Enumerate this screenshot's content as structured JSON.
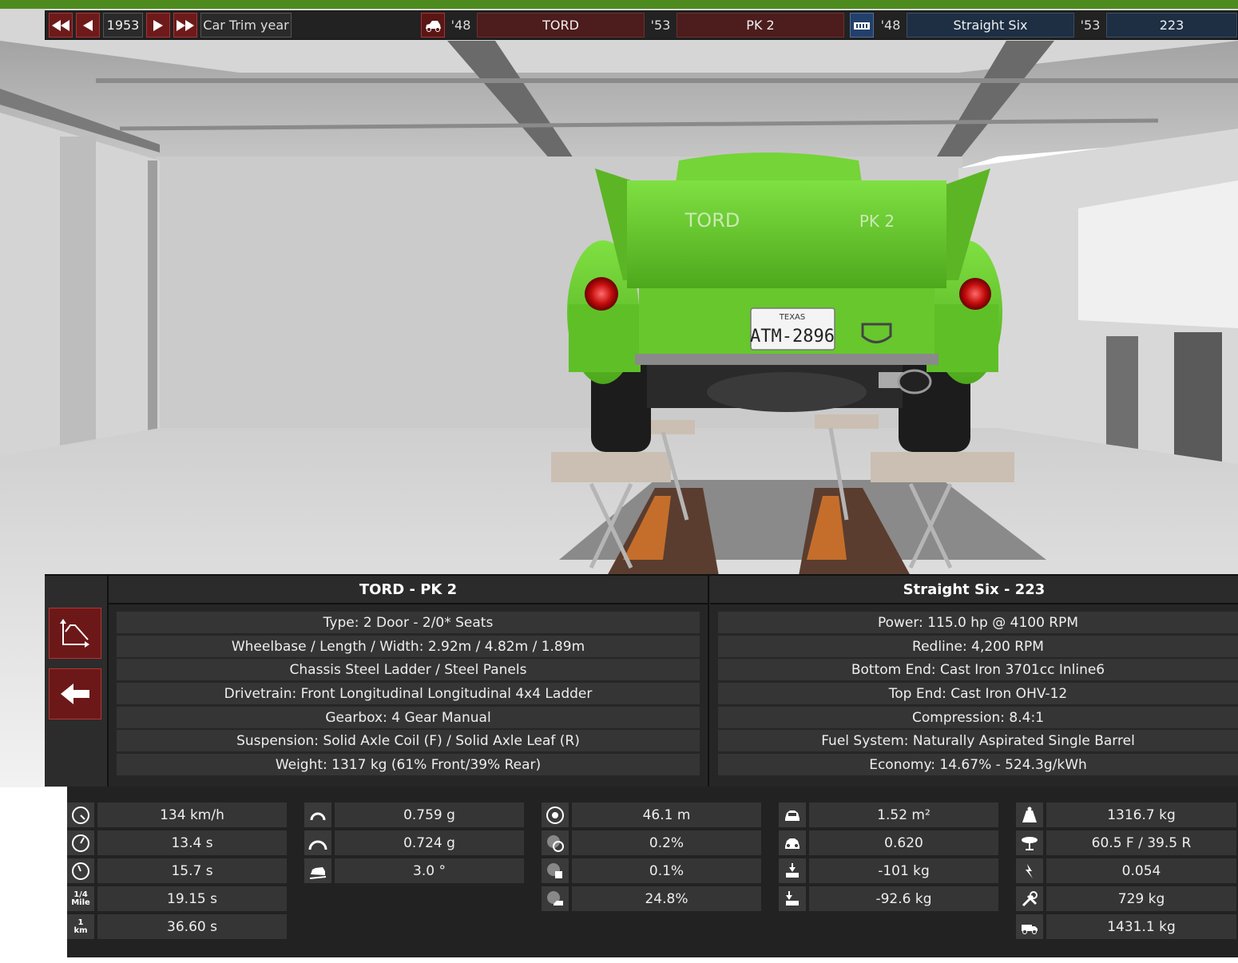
{
  "toolbar": {
    "year": "1953",
    "trim_label": "Car Trim year",
    "car_year_start": "'48",
    "car_make": "TORD",
    "car_year_end": "'53",
    "car_model": "PK 2",
    "engine_year_start": "'48",
    "engine_family": "Straight Six",
    "engine_year_end": "'53",
    "engine_variant": "223",
    "icons": [
      "fast-back-icon",
      "back-icon",
      "forward-icon",
      "fast-forward-icon",
      "car-icon",
      "engine-icon"
    ]
  },
  "plate": {
    "state": "TEXAS",
    "number": "ATM-2896"
  },
  "car_badges": {
    "left": "TORD",
    "right": "PK 2"
  },
  "car_panel": {
    "title": "TORD - PK 2",
    "rows": [
      "Type: 2 Door - 2/0* Seats",
      "Wheelbase / Length / Width: 2.92m / 4.82m / 1.89m",
      "Chassis Steel Ladder / Steel Panels",
      "Drivetrain: Front Longitudinal Longitudinal 4x4 Ladder",
      "Gearbox: 4 Gear Manual",
      "Suspension: Solid Axle Coil (F) / Solid Axle Leaf (R)",
      "Weight: 1317 kg (61% Front/39% Rear)"
    ]
  },
  "engine_panel": {
    "title": "Straight Six - 223",
    "rows": [
      "Power: 115.0 hp @ 4100 RPM",
      "Redline:  4,200 RPM",
      "Bottom End: Cast Iron 3701cc Inline6",
      "Top End: Cast Iron OHV-12",
      "Compression: 8.4:1",
      "Fuel System: Naturally Aspirated Single Barrel",
      "Economy: 14.67% - 524.3g/kWh"
    ]
  },
  "side_buttons": [
    "graph-icon",
    "back-arrow-icon"
  ],
  "stats": {
    "col1": [
      {
        "icon": "top-speed-icon",
        "value": "134 km/h"
      },
      {
        "icon": "accel-0-60-icon",
        "value": "13.4 s"
      },
      {
        "icon": "accel-0-100-icon",
        "value": "15.7 s"
      },
      {
        "icon": "quarter-mile-icon",
        "label_top": "1/4",
        "label_bottom": "Mile",
        "value": "19.15 s"
      },
      {
        "icon": "one-km-icon",
        "label_top": "1",
        "label_bottom": "km",
        "value": "36.60 s"
      }
    ],
    "col2": [
      {
        "icon": "lateral-g-icon",
        "value": "0.759 g"
      },
      {
        "icon": "lateral-g-wide-icon",
        "value": "0.724 g"
      },
      {
        "icon": "body-roll-icon",
        "value": "3.0 °"
      }
    ],
    "col3": [
      {
        "icon": "braking-distance-icon",
        "value": "46.1 m"
      },
      {
        "icon": "understeer-icon",
        "value": "0.2%"
      },
      {
        "icon": "oversteer-icon",
        "value": "0.1%"
      },
      {
        "icon": "brake-fade-icon",
        "value": "24.8%"
      }
    ],
    "col4": [
      {
        "icon": "frontal-area-icon",
        "value": "1.52 m²"
      },
      {
        "icon": "drag-coefficient-icon",
        "value": "0.620"
      },
      {
        "icon": "front-downforce-icon",
        "value": "-101 kg"
      },
      {
        "icon": "rear-downforce-icon",
        "value": "-92.6 kg"
      }
    ],
    "col5": [
      {
        "icon": "weight-icon",
        "value": "1316.7 kg"
      },
      {
        "icon": "weight-distribution-icon",
        "value": "60.5 F / 39.5 R"
      },
      {
        "icon": "power-to-weight-icon",
        "value": "0.054"
      },
      {
        "icon": "towing-icon",
        "value": "729 kg"
      },
      {
        "icon": "payload-icon",
        "value": "1431.1 kg"
      }
    ]
  },
  "colors": {
    "car_green": "#6bd033",
    "button_red": "#6d1818",
    "panel_dark": "#262626",
    "engine_blue": "#1e2f44"
  }
}
